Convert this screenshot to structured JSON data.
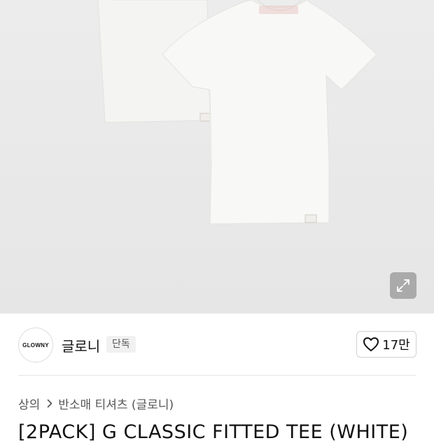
{
  "product_image": {
    "description_icon": "tshirt-image"
  },
  "expand_button": {
    "icon": "expand-icon"
  },
  "brand": {
    "logo_text": "GLOWNY",
    "name": "글로니",
    "badge": "단독"
  },
  "like": {
    "icon": "heart-outline-icon",
    "count": "17만"
  },
  "breadcrumb": {
    "items": [
      "상의",
      "반소매 티셔츠 (글로니)"
    ],
    "separator_icon": "chevron-right-icon"
  },
  "product": {
    "title": "[2PACK] G CLASSIC FITTED TEE (WHITE)"
  },
  "colors": {
    "hero_bg": "#e8e8e8",
    "tee": "#f7f7f5"
  }
}
